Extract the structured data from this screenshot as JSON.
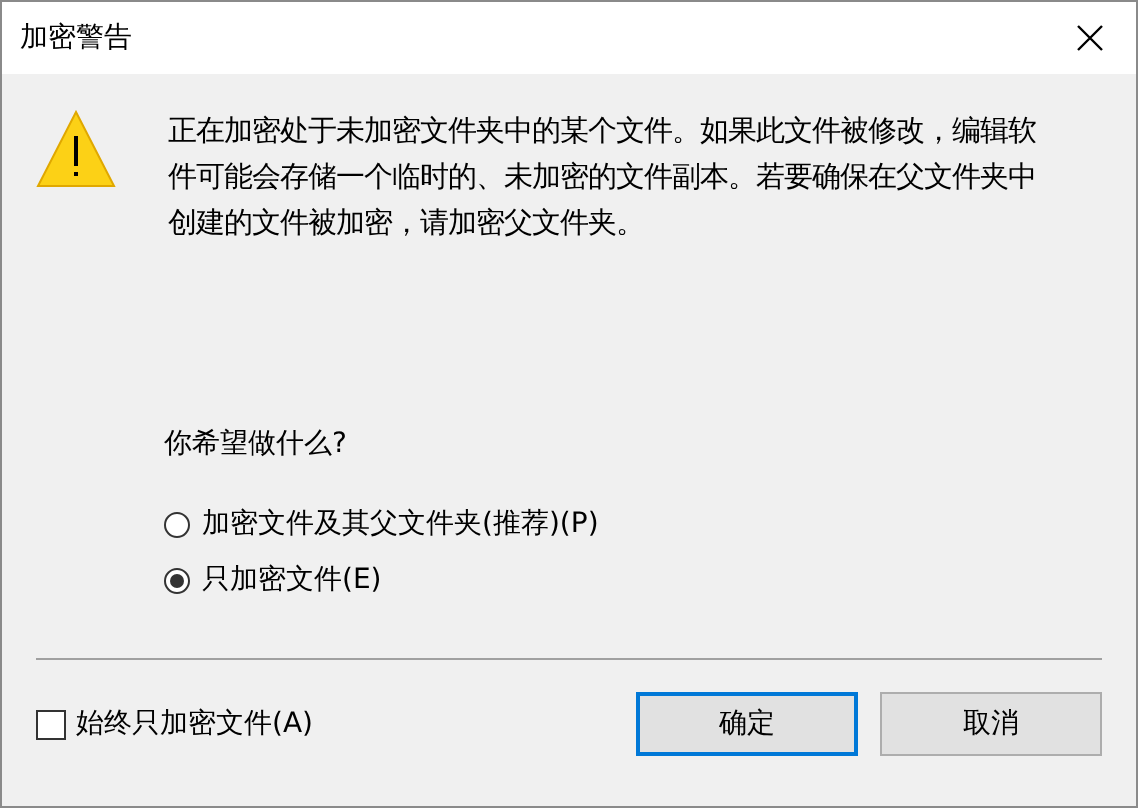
{
  "window": {
    "title": "加密警告"
  },
  "message": "正在加密处于未加密文件夹中的某个文件。如果此文件被修改，编辑软件可能会存储一个临时的、未加密的文件副本。若要确保在父文件夹中创建的文件被加密，请加密父文件夹。",
  "question": "你希望做什么?",
  "options": [
    {
      "label": "加密文件及其父文件夹(推荐)(P)",
      "selected": false
    },
    {
      "label": "只加密文件(E)",
      "selected": true
    }
  ],
  "always_checkbox": {
    "label": "始终只加密文件(A)",
    "checked": false
  },
  "buttons": [
    {
      "label": "确定",
      "default": true
    },
    {
      "label": "取消",
      "default": false
    }
  ]
}
